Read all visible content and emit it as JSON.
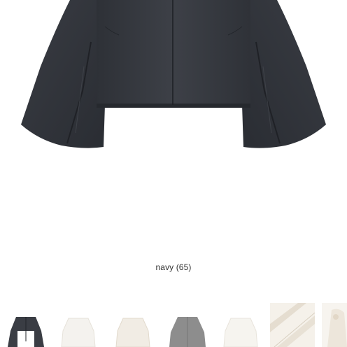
{
  "product": {
    "color_caption": "navy (65)"
  },
  "thumbnails": [
    {
      "name": "navy",
      "fill": "#3a3d44",
      "bg": "#ffffff"
    },
    {
      "name": "ivory",
      "fill": "#f4f2ee",
      "bg": "#ffffff"
    },
    {
      "name": "cream",
      "fill": "#f1ece4",
      "bg": "#ffffff"
    },
    {
      "name": "gray",
      "fill": "#8d8d8d",
      "bg": "#ffffff"
    },
    {
      "name": "white",
      "fill": "#f6f4ef",
      "bg": "#ffffff"
    },
    {
      "name": "detail-cream",
      "fill": "#efe9df",
      "bg": "#f5f1ea"
    },
    {
      "name": "model-cream",
      "fill": "#ede6db",
      "bg": "#f7f4ef"
    }
  ],
  "colors": {
    "garment_navy": "#34373e",
    "garment_shadow": "#23262c",
    "caption_text": "#333333"
  }
}
